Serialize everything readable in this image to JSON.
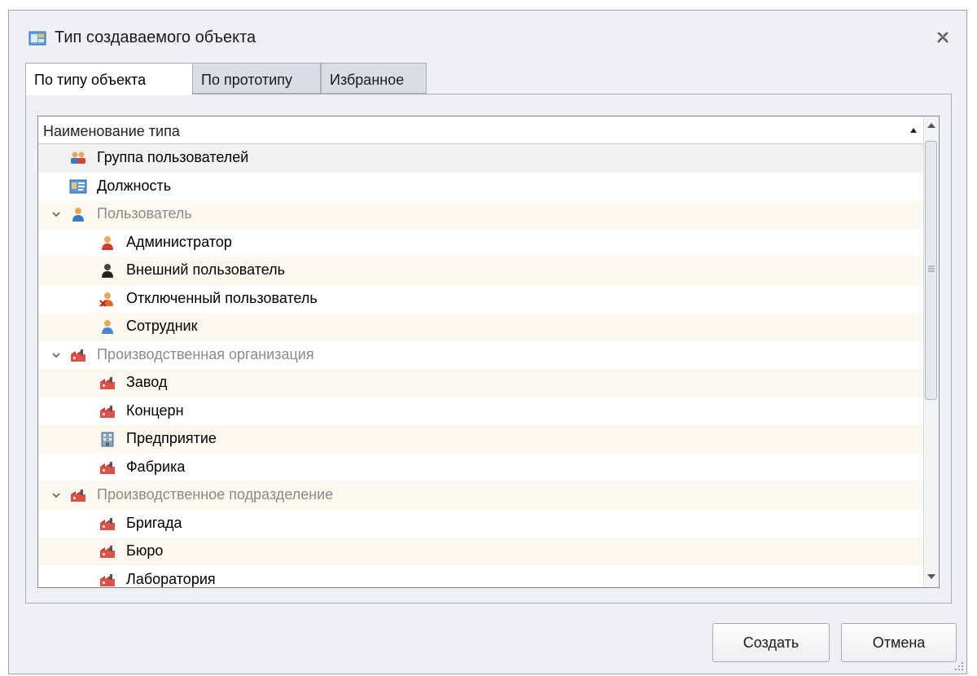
{
  "window": {
    "title": "Тип создаваемого объекта"
  },
  "tabs": [
    {
      "label": "По типу объекта",
      "active": true
    },
    {
      "label": "По прототипу",
      "active": false
    },
    {
      "label": "Избранное",
      "active": false
    }
  ],
  "tree": {
    "column_header": "Наименование типа",
    "items": [
      {
        "label": "Группа пользователей",
        "icon": "user-group-icon"
      },
      {
        "label": "Должность",
        "icon": "position-card-icon"
      },
      {
        "label": "Пользователь",
        "icon": "user-icon",
        "expanded": true
      },
      {
        "label": "Администратор",
        "icon": "admin-user-icon"
      },
      {
        "label": "Внешний пользователь",
        "icon": "external-user-icon"
      },
      {
        "label": "Отключенный пользователь",
        "icon": "disabled-user-icon"
      },
      {
        "label": "Сотрудник",
        "icon": "employee-icon"
      },
      {
        "label": "Производственная организация",
        "icon": "factory-icon",
        "expanded": true
      },
      {
        "label": "Завод",
        "icon": "factory-icon"
      },
      {
        "label": "Концерн",
        "icon": "factory-icon"
      },
      {
        "label": "Предприятие",
        "icon": "building-icon"
      },
      {
        "label": "Фабрика",
        "icon": "factory-icon"
      },
      {
        "label": "Производственное подразделение",
        "icon": "factory-icon",
        "expanded": true
      },
      {
        "label": "Бригада",
        "icon": "factory-icon"
      },
      {
        "label": "Бюро",
        "icon": "factory-icon"
      },
      {
        "label": "Лаборатория",
        "icon": "factory-icon"
      }
    ]
  },
  "buttons": {
    "create": "Создать",
    "cancel": "Отмена"
  },
  "colors": {
    "selection": "#f1f1f1",
    "alt_row": "#fbf8ef",
    "group_text": "#8a8a8a"
  }
}
